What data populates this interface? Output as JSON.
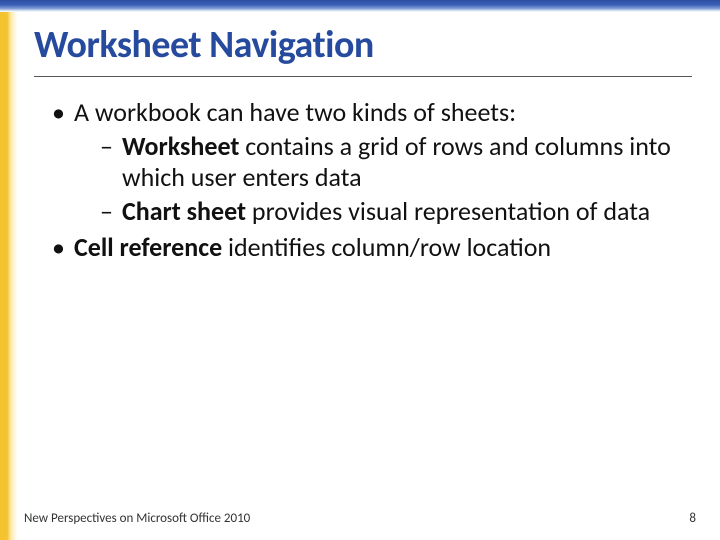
{
  "title": "Worksheet Navigation",
  "bullets": [
    {
      "text": "A workbook can have two kinds of sheets:",
      "sub": [
        {
          "bold": "Worksheet",
          "rest": " contains a grid of rows and columns into which user enters data"
        },
        {
          "bold": "Chart sheet",
          "rest": " provides visual representation of data"
        }
      ]
    },
    {
      "bold": "Cell reference",
      "rest": " identifies column/row location"
    }
  ],
  "footer": {
    "left": "New Perspectives on Microsoft Office 2010",
    "right": "8"
  }
}
